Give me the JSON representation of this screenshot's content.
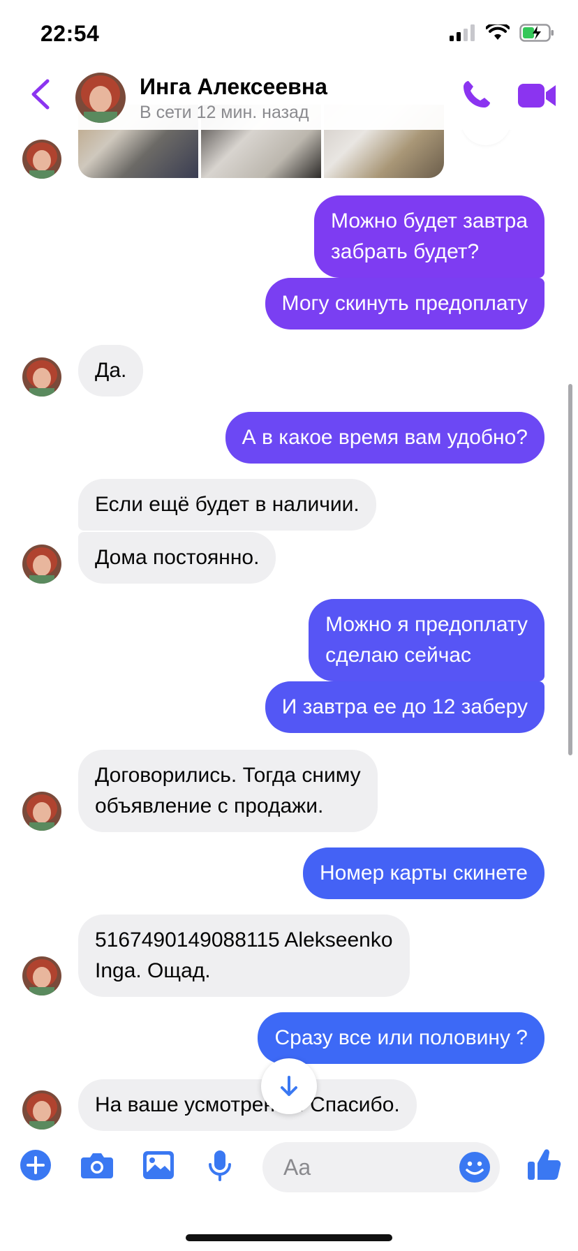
{
  "status": {
    "time": "22:54"
  },
  "header": {
    "name": "Инга Алексеевна",
    "status": "В сети 12 мин. назад"
  },
  "messages": [
    {
      "side": "out",
      "text": "Можно будет завтра\nзабрать будет?",
      "color": "#7e3cf2"
    },
    {
      "side": "out",
      "text": "Могу скинуть предоплату",
      "color": "#7a3ff2"
    },
    {
      "side": "in",
      "text": "Да."
    },
    {
      "side": "out",
      "text": "А в какое время вам удобно?",
      "color": "#6c48f4"
    },
    {
      "side": "in",
      "text": "Если ещё будет в наличии."
    },
    {
      "side": "in",
      "text": "Дома постоянно."
    },
    {
      "side": "out",
      "text": "Можно я предоплату\nсделаю сейчас",
      "color": "#5755f5"
    },
    {
      "side": "out",
      "text": "И завтра ее до 12 заберу",
      "color": "#5357f5"
    },
    {
      "side": "in",
      "text": "Договорились. Тогда сниму\nобъявление с продажи."
    },
    {
      "side": "out",
      "text": "Номер карты скинете",
      "color": "#4462f5"
    },
    {
      "side": "in",
      "text": "5167490149088115 Alekseenko\nInga. Ощад."
    },
    {
      "side": "out",
      "text": "Сразу все или половину ?",
      "color": "#3d69f6"
    },
    {
      "side": "in",
      "text": "На ваше усмотрение. Спасибо."
    }
  ],
  "composer": {
    "placeholder": "Aa"
  },
  "colors": {
    "accent": "#8b34f0",
    "composer_icons": "#3a78f2"
  },
  "icons": [
    "back-arrow",
    "phone",
    "video-camera",
    "plus",
    "camera",
    "image",
    "microphone",
    "emoji",
    "thumbs-up",
    "arrow-down"
  ]
}
